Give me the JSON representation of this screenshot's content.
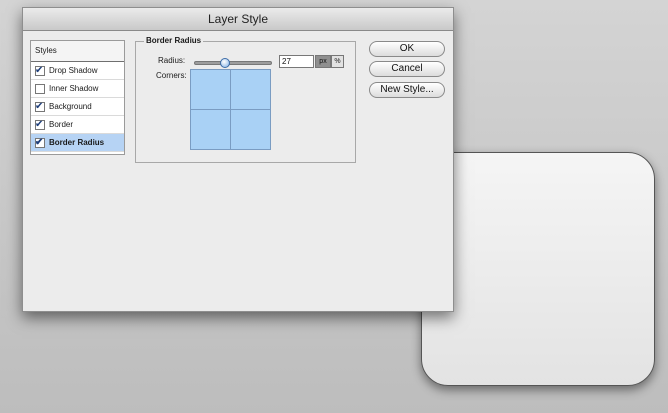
{
  "dialog": {
    "title": "Layer Style"
  },
  "styles_panel": {
    "header": "Styles",
    "items": [
      {
        "label": "Drop Shadow",
        "checked": true,
        "selected": false
      },
      {
        "label": "Inner Shadow",
        "checked": false,
        "selected": false
      },
      {
        "label": "Background",
        "checked": true,
        "selected": false
      },
      {
        "label": "Border",
        "checked": true,
        "selected": false
      },
      {
        "label": "Border Radius",
        "checked": true,
        "selected": true
      }
    ]
  },
  "border_radius": {
    "section_title": "Border Radius",
    "radius_label": "Radius:",
    "radius_value": "27",
    "slider_fraction": 0.38,
    "unit_px": "px",
    "unit_percent": "%",
    "selected_unit": "px",
    "corners_label": "Corners:"
  },
  "buttons": {
    "ok": "OK",
    "cancel": "Cancel",
    "new_style": "New Style..."
  },
  "colors": {
    "selection": "#b6d3f4",
    "corner_fill": "#a9d1f5",
    "dialog_bg": "#ececec"
  }
}
